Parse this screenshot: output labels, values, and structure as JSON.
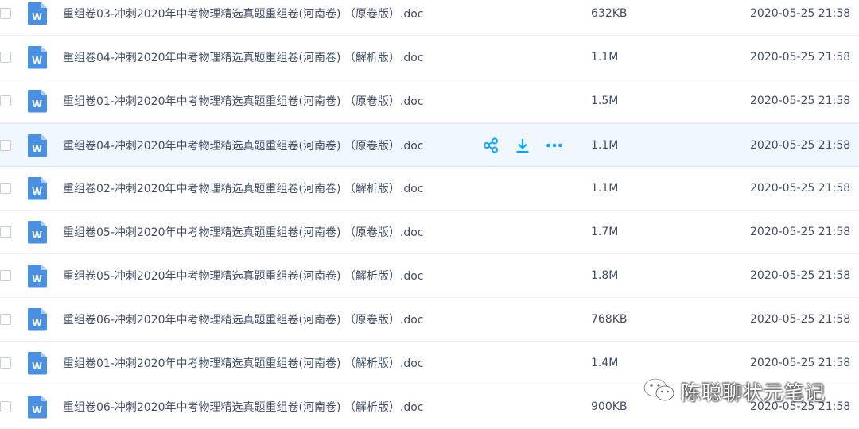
{
  "colors": {
    "accent": "#06a7ff",
    "doc_icon": "#4a90e2",
    "text": "#424e67",
    "hover_row": "#f1f7fe"
  },
  "files": [
    {
      "name": "重组卷03-冲刺2020年中考物理精选真题重组卷(河南卷) （原卷版）.doc",
      "size": "632KB",
      "date": "2020-05-25 21:58",
      "icon": "word-doc-icon",
      "hovered": false
    },
    {
      "name": "重组卷04-冲刺2020年中考物理精选真题重组卷(河南卷) （解析版）.doc",
      "size": "1.1M",
      "date": "2020-05-25 21:58",
      "icon": "word-doc-icon",
      "hovered": false
    },
    {
      "name": "重组卷01-冲刺2020年中考物理精选真题重组卷(河南卷) （原卷版）.doc",
      "size": "1.5M",
      "date": "2020-05-25 21:58",
      "icon": "word-doc-icon",
      "hovered": false
    },
    {
      "name": "重组卷04-冲刺2020年中考物理精选真题重组卷(河南卷) （原卷版）.doc",
      "size": "1.1M",
      "date": "2020-05-25 21:58",
      "icon": "word-doc-icon",
      "hovered": true
    },
    {
      "name": "重组卷02-冲刺2020年中考物理精选真题重组卷(河南卷) （解析版）.doc",
      "size": "1.1M",
      "date": "2020-05-25 21:58",
      "icon": "word-doc-icon",
      "hovered": false
    },
    {
      "name": "重组卷05-冲刺2020年中考物理精选真题重组卷(河南卷) （原卷版）.doc",
      "size": "1.7M",
      "date": "2020-05-25 21:58",
      "icon": "word-doc-icon",
      "hovered": false
    },
    {
      "name": "重组卷05-冲刺2020年中考物理精选真题重组卷(河南卷) （解析版）.doc",
      "size": "1.8M",
      "date": "2020-05-25 21:58",
      "icon": "word-doc-icon",
      "hovered": false
    },
    {
      "name": "重组卷06-冲刺2020年中考物理精选真题重组卷(河南卷) （原卷版）.doc",
      "size": "768KB",
      "date": "2020-05-25 21:58",
      "icon": "word-doc-icon",
      "hovered": false
    },
    {
      "name": "重组卷01-冲刺2020年中考物理精选真题重组卷(河南卷) （解析版）.doc",
      "size": "1.4M",
      "date": "2020-05-25 21:58",
      "icon": "word-doc-icon",
      "hovered": false
    },
    {
      "name": "重组卷06-冲刺2020年中考物理精选真题重组卷(河南卷) （解析版）.doc",
      "size": "900KB",
      "date": "2020-05-25 21:58",
      "icon": "word-doc-icon",
      "hovered": false
    }
  ],
  "hover_actions": [
    "share-icon",
    "download-icon",
    "more-icon"
  ],
  "watermark": {
    "icon": "wechat-icon",
    "text": "陈聪聊状元笔记"
  }
}
